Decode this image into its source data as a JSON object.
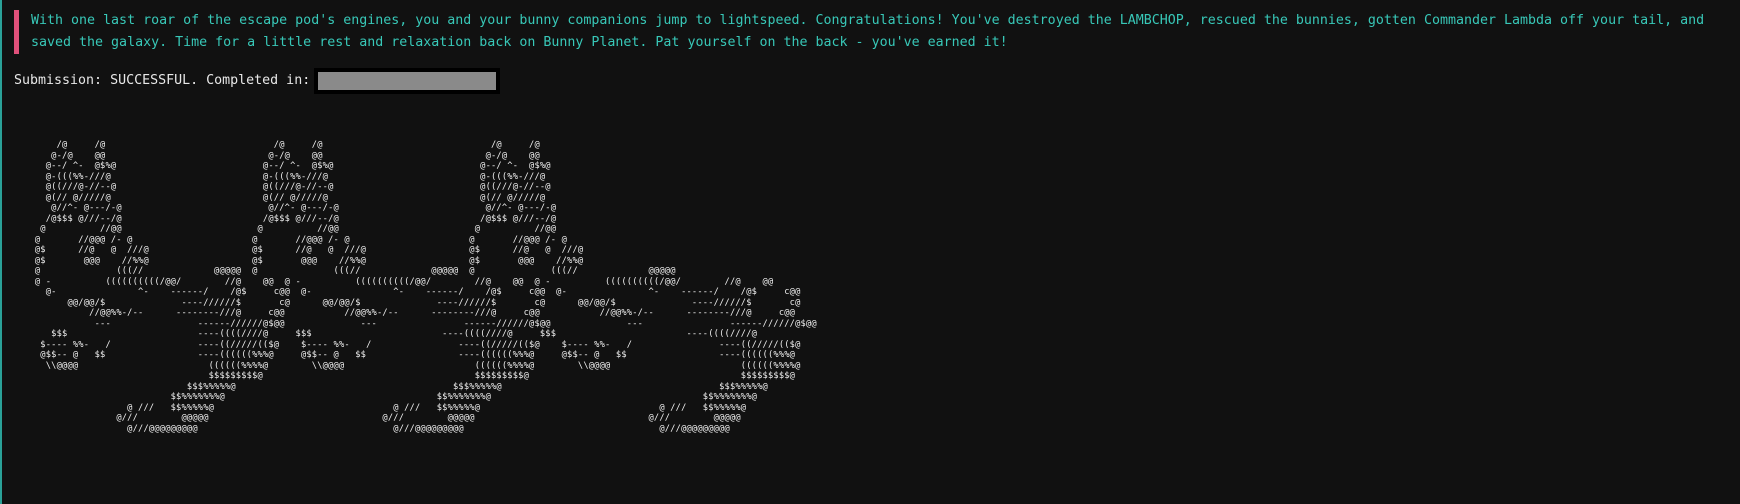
{
  "colors": {
    "background": "#111111",
    "message_text": "#38c8b8",
    "message_bar": "#e0507a",
    "submission_text": "#e8e8e8",
    "completion_bar": "#8a8a8a"
  },
  "message": {
    "text": "With one last roar of the escape pod's engines, you and your bunny companions jump to lightspeed. Congratulations! You've destroyed the LAMBCHOP, rescued the bunnies, gotten Commander Lambda off your tail, and saved the galaxy. Time for a little rest and relaxation back on Bunny Planet. Pat yourself on the back - you've earned it!"
  },
  "submission": {
    "label": "Submission: SUCCESSFUL. Completed in:",
    "completion_fill": 1.0
  },
  "ascii_art": {
    "text": "      /@     /@                               /@     /@                               /@     /@\n     @-/@    @@                              @-/@    @@                              @-/@    @@\n    @--/ ^-  @$%@                           @--/ ^-  @$%@                           @--/ ^-  @$%@\n    @-(((%%-///@                            @-(((%%-///@                            @-(((%%-///@\n    @((///@-//--@                           @((///@-//--@                           @((///@-//--@\n    @(// @/////@                            @(// @/////@                            @(// @/////@\n     @//^- @---/-@                           @//^- @---/-@                           @//^- @---/-@\n    /@$$$ @///--/@                          /@$$$ @///--/@                          /@$$$ @///--/@\n   @          //@@                         @          //@@                         @          //@@\n  @       //@@@ /- @                      @       //@@@ /- @                      @       //@@@ /- @\n  @$      //@   @  ///@                   @$      //@   @  ///@                   @$      //@   @  ///@\n  @$       @@@    //%%@                   @$       @@@    //%%@                   @$       @@@    //%%@\n  @              (((//             @@@@@  @              (((//             @@@@@  @              (((//             @@@@@\n  @ -          ((((((((((/@@/        //@    @@  @ -          ((((((((((/@@/        //@    @@  @ -          ((((((((((/@@/        //@    @@\n    @-               ^-    ------/    /@$     c@@  @-               ^-    ------/    /@$     c@@  @-               ^-    ------/    /@$     c@@\n        @@/@@/$              ----//////$       c@      @@/@@/$              ----//////$       c@      @@/@@/$              ----//////$       c@\n            //@@%%-/--      --------///@     c@@           //@@%%-/--      --------///@     c@@           //@@%%-/--      --------///@     c@@\n             ---                ------//////@$@@              ---                ------//////@$@@              ---                ------//////@$@@\n     $$$                        ----((((////@     $$$                        ----((((////@     $$$                        ----((((////@\n   $---- %%-   /                ----((/////(($@    $---- %%-   /                ----((/////(($@    $---- %%-   /                ----((/////(($@\n   @$$-- @   $$                 ----((((((%%%@     @$$-- @   $$                 ----((((((%%%@     @$$-- @   $$                 ----((((((%%%@\n    \\\\@@@@                        ((((((%%%%@        \\\\@@@@                        ((((((%%%%@        \\\\@@@@                        ((((((%%%%@\n                                  $$$$$$$$$@                                       $$$$$$$$$@                                       $$$$$$$$$@\n                              $$$%%%%%@                                        $$$%%%%%@                                        $$$%%%%%@\n                           $$%%%%%%%@                                       $$%%%%%%%@                                       $$%%%%%%%@\n                   @ ///   $$%%%%%@                                 @ ///   $$%%%%%@                                 @ ///   $$%%%%%@\n                 @///        @@@@@                                @///        @@@@@                                @///        @@@@@\n                   @///@@@@@@@@@                                    @///@@@@@@@@@                                    @///@@@@@@@@@"
  }
}
